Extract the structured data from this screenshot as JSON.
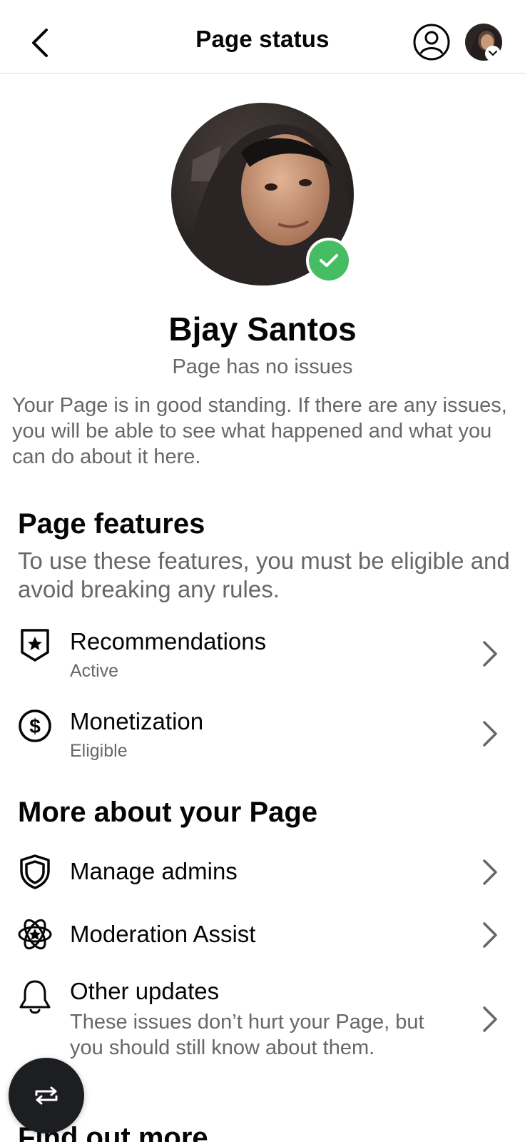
{
  "header": {
    "title": "Page status",
    "back_icon": "chevron-left-icon",
    "profile_icon": "person-circle-icon"
  },
  "profile": {
    "name": "Bjay Santos",
    "status": "Page has no issues",
    "description": "Your Page is in good standing. If there are any issues, you will be able to see what happened and what you can do about it here.",
    "badge_color": "#45bd62"
  },
  "features": {
    "title": "Page features",
    "subtitle": "To use these features, you must be eligible and avoid breaking any rules.",
    "items": [
      {
        "label": "Recommendations",
        "status": "Active",
        "icon": "star-shield-icon"
      },
      {
        "label": "Monetization",
        "status": "Eligible",
        "icon": "dollar-circle-icon"
      }
    ]
  },
  "more": {
    "title": "More about your Page",
    "items": [
      {
        "label": "Manage admins",
        "icon": "shield-icon"
      },
      {
        "label": "Moderation Assist",
        "icon": "atom-star-icon"
      },
      {
        "label": "Other updates",
        "description": "These issues don’t hurt your Page, but you should still know about them.",
        "icon": "bell-icon"
      }
    ]
  },
  "find_out": {
    "title": "Find out more"
  },
  "fab": {
    "icon": "switch-arrows-icon"
  }
}
